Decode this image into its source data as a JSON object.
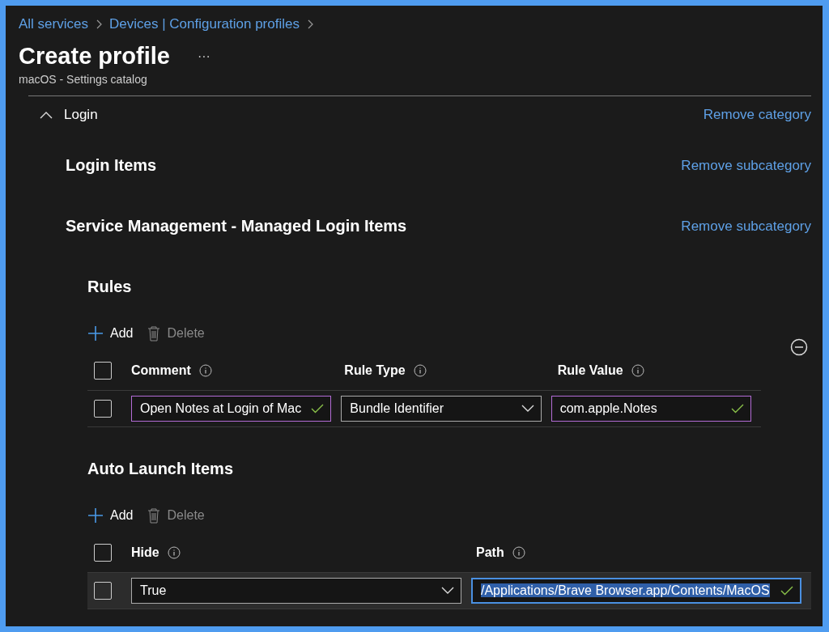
{
  "breadcrumbs": [
    {
      "label": "All services"
    },
    {
      "label": "Devices | Configuration profiles"
    }
  ],
  "title": "Create profile",
  "more_button": "···",
  "subtitle": "macOS - Settings catalog",
  "category": {
    "label": "Login",
    "expanded": true,
    "remove_link": "Remove category",
    "subcategories": [
      {
        "title": "Login Items",
        "remove_link": "Remove subcategory"
      },
      {
        "title": "Service Management - Managed Login Items",
        "remove_link": "Remove subcategory",
        "tables": [
          {
            "title": "Rules",
            "removable": true,
            "select_all_checked": false,
            "add": "Add",
            "delete": "Delete",
            "columns": [
              {
                "label": "Comment"
              },
              {
                "label": "Rule Type"
              },
              {
                "label": "Rule Value"
              }
            ],
            "rows": [
              {
                "checked": false,
                "hovered": false,
                "cells": [
                  {
                    "kind": "text",
                    "value": "Open Notes at Login of Mac",
                    "valid": true,
                    "focused": false
                  },
                  {
                    "kind": "dropdown",
                    "value": "Bundle Identifier",
                    "focused": false
                  },
                  {
                    "kind": "text",
                    "value": "com.apple.Notes",
                    "valid": true,
                    "focused": false
                  }
                ]
              }
            ]
          },
          {
            "title": "Auto Launch Items",
            "select_all_checked": false,
            "add": "Add",
            "delete": "Delete",
            "columns": [
              {
                "label": "Hide"
              },
              {
                "label": "Path"
              }
            ],
            "rows": [
              {
                "checked": false,
                "hovered": true,
                "cells": [
                  {
                    "kind": "dropdown",
                    "value": "True",
                    "focused": false
                  },
                  {
                    "kind": "text",
                    "value": "/Applications/Brave Browser.app/Contents/MacOS",
                    "valid": true,
                    "focused": true
                  }
                ]
              }
            ]
          }
        ]
      }
    ]
  }
}
